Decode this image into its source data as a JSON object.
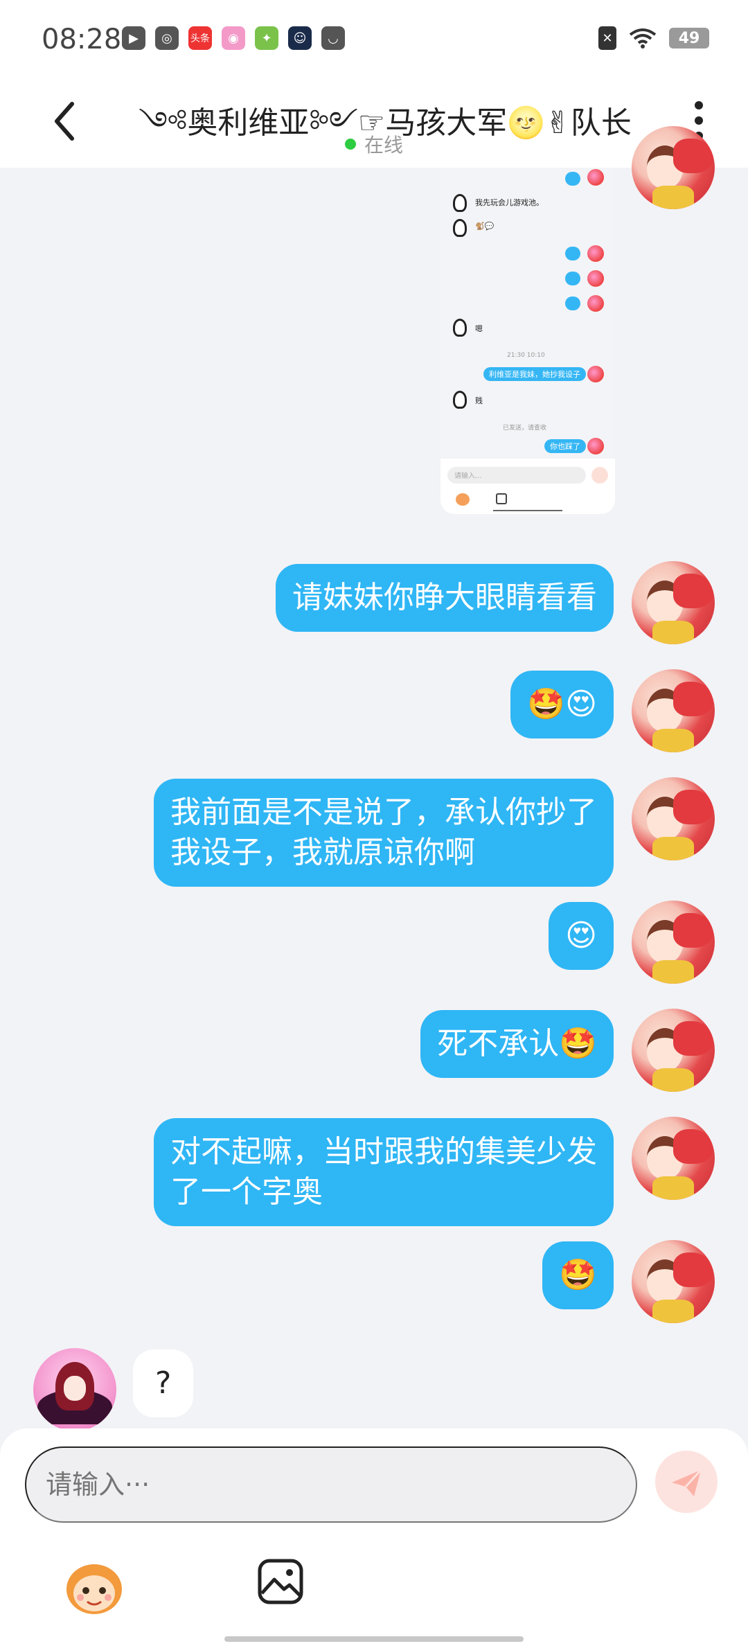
{
  "status_bar": {
    "time": "08:28",
    "battery": "49",
    "icons": [
      "video-app-icon",
      "browser-icon",
      "toutiao-icon",
      "camera-app-icon",
      "game-app-icon",
      "ai-app-icon",
      "store-icon"
    ],
    "toutiao_label": "头条"
  },
  "header": {
    "title": "༺奥利维亚༻☞马孩大军🌝✌队长",
    "status": "在线",
    "status_color": "#2ecc40"
  },
  "embedded_screenshot": {
    "msg1": "我先玩会儿游戏池。",
    "msg2": "嗯",
    "time": "21:30 10:10",
    "msg3": "利维亚是我妹，她抄我设子",
    "msg4": "贱",
    "notice": "已发送，请查收",
    "msg5": "你也踩了",
    "input_placeholder": "请输入..."
  },
  "messages": [
    {
      "from": "me",
      "text": "请妹妹你睁大眼睛看看"
    },
    {
      "from": "me",
      "text": "🤩😍"
    },
    {
      "from": "me",
      "text_line1": "我前面是不是说了，承认你抄了",
      "text_line2": "我设子，我就原谅你啊"
    },
    {
      "from": "me",
      "text": "😍"
    },
    {
      "from": "me",
      "text": "死不承认🤩"
    },
    {
      "from": "me",
      "text_line1": "对不起嘛，当时跟我的集美少发",
      "text_line2": "了一个字奥"
    },
    {
      "from": "me",
      "text": "🤩"
    },
    {
      "from": "other",
      "text": "?"
    }
  ],
  "input": {
    "placeholder": "请输入···"
  },
  "colors": {
    "my_bubble": "#2fb6f5",
    "background": "#f2f3f6"
  }
}
